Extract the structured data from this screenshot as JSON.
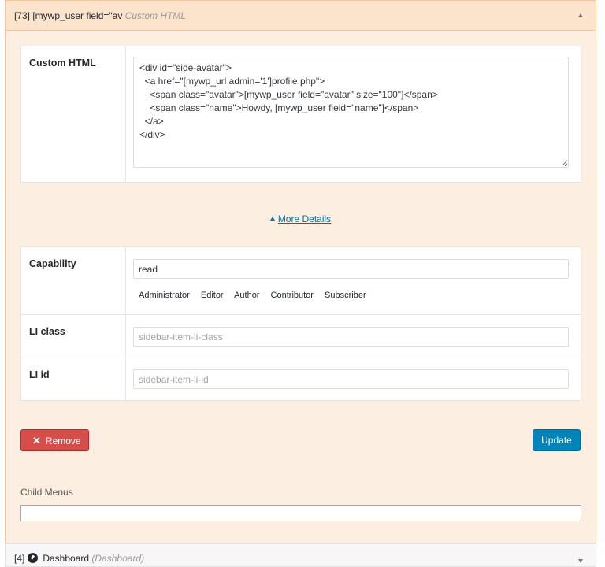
{
  "item": {
    "header_tag": "[73] [mywp_user field=\"av",
    "header_type": "Custom HTML"
  },
  "custom_html": {
    "label": "Custom HTML",
    "code": "<div id=\"side-avatar\">\n  <a href=\"[mywp_url admin='1']profile.php\">\n    <span class=\"avatar\">[mywp_user field=\"avatar\" size=\"100\"]</span>\n    <span class=\"name\">Howdy, [mywp_user field=\"name\"]</span>\n  </a>\n</div>"
  },
  "more_details": "More Details",
  "capability": {
    "label": "Capability",
    "value": "read",
    "roles": [
      "Administrator",
      "Editor",
      "Author",
      "Contributor",
      "Subscriber"
    ]
  },
  "li_class": {
    "label": "LI class",
    "placeholder": "sidebar-item-li-class"
  },
  "li_id": {
    "label": "LI id",
    "placeholder": "sidebar-item-li-id"
  },
  "buttons": {
    "remove": "Remove",
    "update": "Update"
  },
  "child_menus_label": "Child Menus",
  "next_item": {
    "tag": "[4]",
    "title": "Dashboard",
    "type": "(Dashboard)"
  },
  "icons": {
    "collapse": "chevron-up-icon",
    "expand": "chevron-down-icon",
    "remove": "close-icon",
    "dashboard": "dashboard-icon"
  },
  "colors": {
    "panel_bg": "#fcefe1",
    "header_bg": "#fbe4cb",
    "remove_button": "#d54e4a",
    "update_button": "#0085ba",
    "link": "#0073aa"
  }
}
